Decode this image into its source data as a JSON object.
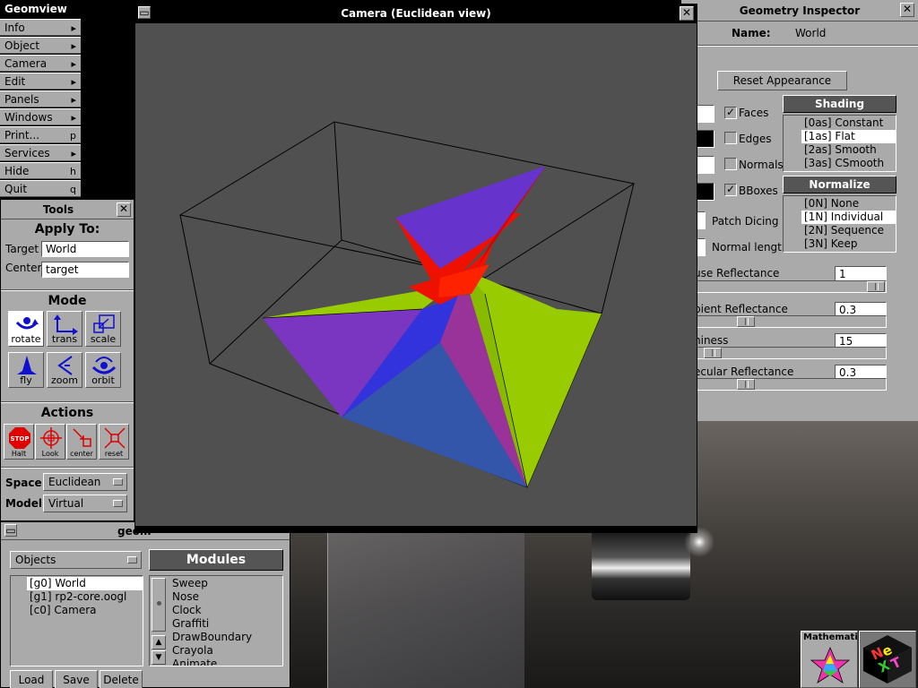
{
  "colors": {
    "accent_blue": "#1010d0",
    "stop_red": "#e00000",
    "viewport_bg": "#505050",
    "face_purple": "#6633cc",
    "face_red": "#ee1100",
    "face_green": "#99cc00",
    "face_blue": "#3355aa",
    "face_magenta": "#993399"
  },
  "main_menu": {
    "title": "Geomview",
    "items": [
      {
        "label": "Info",
        "key": "▸"
      },
      {
        "label": "Object",
        "key": "▸"
      },
      {
        "label": "Camera",
        "key": "▸"
      },
      {
        "label": "Edit",
        "key": "▸"
      },
      {
        "label": "Panels",
        "key": "▸"
      },
      {
        "label": "Windows",
        "key": "▸"
      },
      {
        "label": "Print...",
        "key": "p"
      },
      {
        "label": "Services",
        "key": "▸"
      },
      {
        "label": "Hide",
        "key": "h"
      },
      {
        "label": "Quit",
        "key": "q"
      }
    ]
  },
  "tools": {
    "title": "Tools",
    "apply_to": "Apply To:",
    "target_label": "Target",
    "target_value": "World",
    "center_label": "Center",
    "center_value": "target",
    "mode_heading": "Mode",
    "modes": [
      "rotate",
      "trans",
      "scale",
      "fly",
      "zoom",
      "orbit"
    ],
    "actions_heading": "Actions",
    "actions": [
      "Halt",
      "Look",
      "center",
      "reset"
    ],
    "stop_text": "STOP",
    "space_label": "Space",
    "space_value": "Euclidean",
    "model_label": "Model",
    "model_value": "Virtual"
  },
  "camera": {
    "title": "Camera (Euclidean view)"
  },
  "inspector": {
    "title": "Geometry Inspector",
    "name_label": "Name:",
    "name_value": "World",
    "reset_button": "Reset Appearance",
    "checks": [
      {
        "label": "Faces",
        "checked": true
      },
      {
        "label": "Edges",
        "checked": false
      },
      {
        "label": "Normals",
        "checked": false
      },
      {
        "label": "BBoxes",
        "checked": true
      }
    ],
    "patch_dicing": "Patch Dicing",
    "normal_length": "Normal length",
    "shading_heading": "Shading",
    "shading_options": [
      "[0as] Constant",
      "[1as] Flat",
      "[2as] Smooth",
      "[3as] CSmooth"
    ],
    "shading_selected": 1,
    "normalize_heading": "Normalize",
    "normalize_options": [
      "[0N] None",
      "[1N] Individual",
      "[2N] Sequence",
      "[3N] Keep"
    ],
    "normalize_selected": 1,
    "sliders": [
      {
        "label": "use Reflectance",
        "value": "1",
        "level": 1.0
      },
      {
        "label": "bient Reflectance",
        "value": "0.3",
        "level": 0.3
      },
      {
        "label": "niness",
        "value": "15",
        "level": 0.0
      },
      {
        "label": "ecular Reflectance",
        "value": "0.3",
        "level": 0.3
      }
    ]
  },
  "geomview_panel": {
    "title": "geom",
    "objects_popup": "Objects",
    "objects": [
      "[g0] World",
      "[g1] rp2-core.oogl",
      "[c0] Camera"
    ],
    "modules_heading": "Modules",
    "modules": [
      "Sweep",
      "Nose",
      "Clock",
      "Graffiti",
      "DrawBoundary",
      "Crayola",
      "Animate"
    ],
    "buttons": [
      "Load",
      "Save",
      "Delete"
    ]
  },
  "dock": {
    "mathematica_label": "Mathemati",
    "next_text": "NeXT"
  }
}
